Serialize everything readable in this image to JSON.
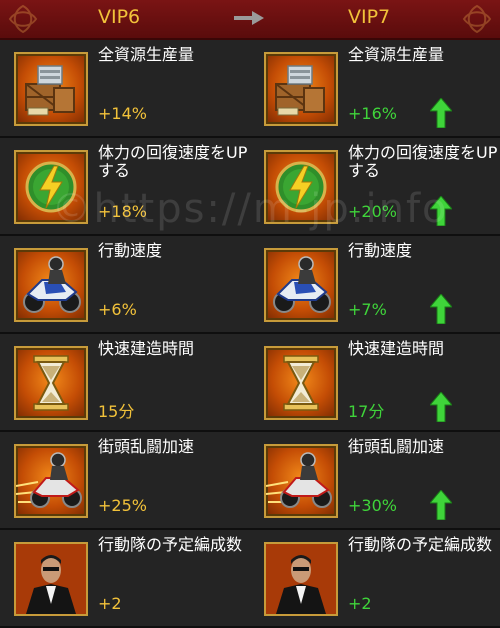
{
  "header": {
    "from_level": "VIP6",
    "to_level": "VIP7"
  },
  "watermark": "©https://m-jp.info",
  "rows": [
    {
      "label": "全資源生産量",
      "old": "+14%",
      "new": "+16%",
      "icon": "resource-crate-icon"
    },
    {
      "label": "体力の回復速度をUPする",
      "old": "+18%",
      "new": "+20%",
      "icon": "lightning-emblem-icon"
    },
    {
      "label": "行動速度",
      "old": "+6%",
      "new": "+7%",
      "icon": "motorcycle-rider-icon"
    },
    {
      "label": "快速建造時間",
      "old": "15分",
      "new": "17分",
      "icon": "hourglass-icon"
    },
    {
      "label": "街頭乱闘加速",
      "old": "+25%",
      "new": "+30%",
      "icon": "speeding-rider-icon"
    },
    {
      "label": "行動隊の予定編成数",
      "old": "+2",
      "new": "+2",
      "icon": "suited-man-icon"
    }
  ],
  "colors": {
    "header": "#6b1010",
    "old_value": "#f2c23a",
    "new_value": "#3fd43a",
    "icon_bg": "#e0700f"
  }
}
